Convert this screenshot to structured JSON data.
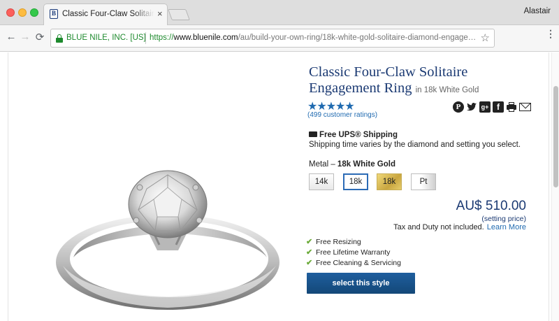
{
  "browser": {
    "tab": {
      "title": "Classic Four-Claw Solitaire Eng",
      "close": "×"
    },
    "profile": "Alastair",
    "nav": {
      "back": "←",
      "forward": "→",
      "reload": "⟳",
      "star": "☆",
      "menu": "⋮"
    },
    "omnibox": {
      "org": "BLUE NILE, INC. [US]",
      "url_scheme": "https://",
      "url_host": "www.bluenile.com",
      "url_path": "/au/build-your-own-ring/18k-white-gold-solitaire-diamond-engage…"
    }
  },
  "product": {
    "title": "Classic Four-Claw Solitaire Engagement Ring",
    "subtitle": "in 18k White Gold",
    "stars": "★★★★★",
    "ratings": "(499 customer ratings)",
    "rating_value": 5,
    "share_icons": [
      "pinterest-icon",
      "twitter-icon",
      "google-plus-icon",
      "facebook-icon",
      "print-icon",
      "email-icon"
    ],
    "shipping": {
      "title": "Free UPS® Shipping",
      "text": "Shipping time varies by the diamond and setting you select."
    },
    "metal": {
      "label": "Metal –",
      "selected": "18k White Gold",
      "options": [
        "14k",
        "18k",
        "18k",
        "Pt"
      ]
    },
    "price": "AU$ 510.00",
    "setting_price": "(setting price)",
    "tax": "Tax and Duty not included.",
    "learn_more": "Learn More",
    "features": [
      "Free Resizing",
      "Free Lifetime Warranty",
      "Free Cleaning & Servicing"
    ],
    "select_button": "select this style"
  },
  "colors": {
    "brand_navy": "#1b3a73",
    "link_blue": "#1f6ab0",
    "check_green": "#6cab3a",
    "button_blue": "#1a5690"
  }
}
